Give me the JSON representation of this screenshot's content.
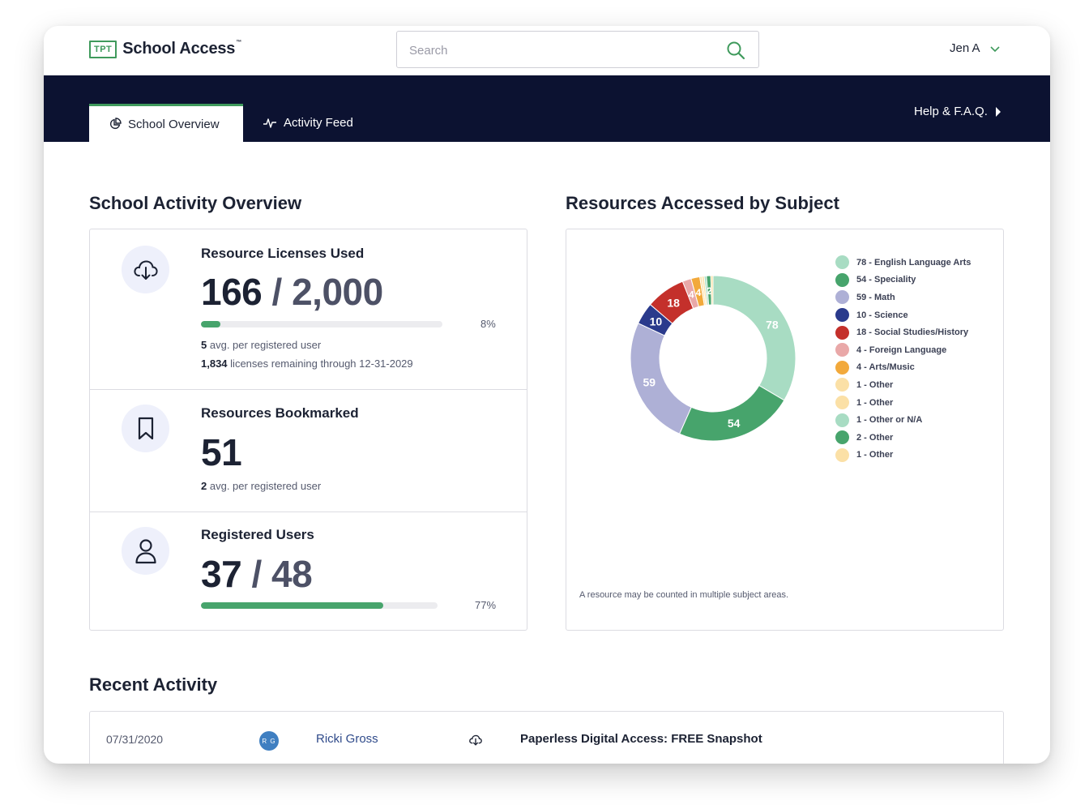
{
  "brand": {
    "badge": "TPT",
    "name": "School Access",
    "tm": "™"
  },
  "search": {
    "placeholder": "Search"
  },
  "user": {
    "name": "Jen A"
  },
  "nav": {
    "tabs": [
      {
        "label": "School Overview",
        "active": true
      },
      {
        "label": "Activity Feed",
        "active": false
      }
    ],
    "help": "Help & F.A.Q."
  },
  "overview": {
    "title": "School Activity Overview",
    "licenses": {
      "label": "Resource Licenses Used",
      "used": "166",
      "slash": "/",
      "total": "2,000",
      "progress": 0.08,
      "pct": "8%",
      "avg_value": "5",
      "avg_text": "avg. per registered user",
      "remaining_value": "1,834",
      "remaining_text": "licenses remaining through 12-31-2029"
    },
    "bookmarked": {
      "label": "Resources Bookmarked",
      "value": "51",
      "avg_value": "2",
      "avg_text": "avg. per registered user"
    },
    "users": {
      "label": "Registered Users",
      "registered": "37",
      "slash": "/",
      "total": "48",
      "progress": 0.77,
      "pct": "77%"
    }
  },
  "subjects": {
    "title": "Resources Accessed by Subject",
    "footnote": "A resource may be counted in multiple subject areas."
  },
  "chart_data": {
    "type": "pie",
    "categories": [
      "English Language Arts",
      "Speciality",
      "Math",
      "Science",
      "Social Studies/History",
      "Foreign Language",
      "Arts/Music",
      "Other",
      "Other",
      "Other or N/A",
      "Other",
      "Other"
    ],
    "values": [
      78,
      54,
      59,
      10,
      18,
      4,
      4,
      1,
      1,
      1,
      2,
      1
    ],
    "legend_labels": [
      "78 - English Language Arts",
      "54 - Speciality",
      "59 - Math",
      "10 - Science",
      "18 - Social Studies/History",
      "4 - Foreign Language",
      "4 - Arts/Music",
      "1 - Other",
      "1 - Other",
      "1 - Other or N/A",
      "2 - Other",
      "1 - Other"
    ],
    "colors": [
      "#a8dcc3",
      "#47a46c",
      "#aeb0d6",
      "#2a3a8c",
      "#c4302b",
      "#e9a8a8",
      "#f2a93b",
      "#fbe0a6",
      "#fbe0a6",
      "#a8dcc3",
      "#47a46c",
      "#fbe0a6"
    ],
    "legend": "right"
  },
  "recent": {
    "title": "Recent Activity",
    "rows": [
      {
        "date": "07/31/2020",
        "initials": "R G",
        "user": "Ricki Gross",
        "title": "Paperless Digital Access: FREE Snapshot"
      }
    ]
  }
}
